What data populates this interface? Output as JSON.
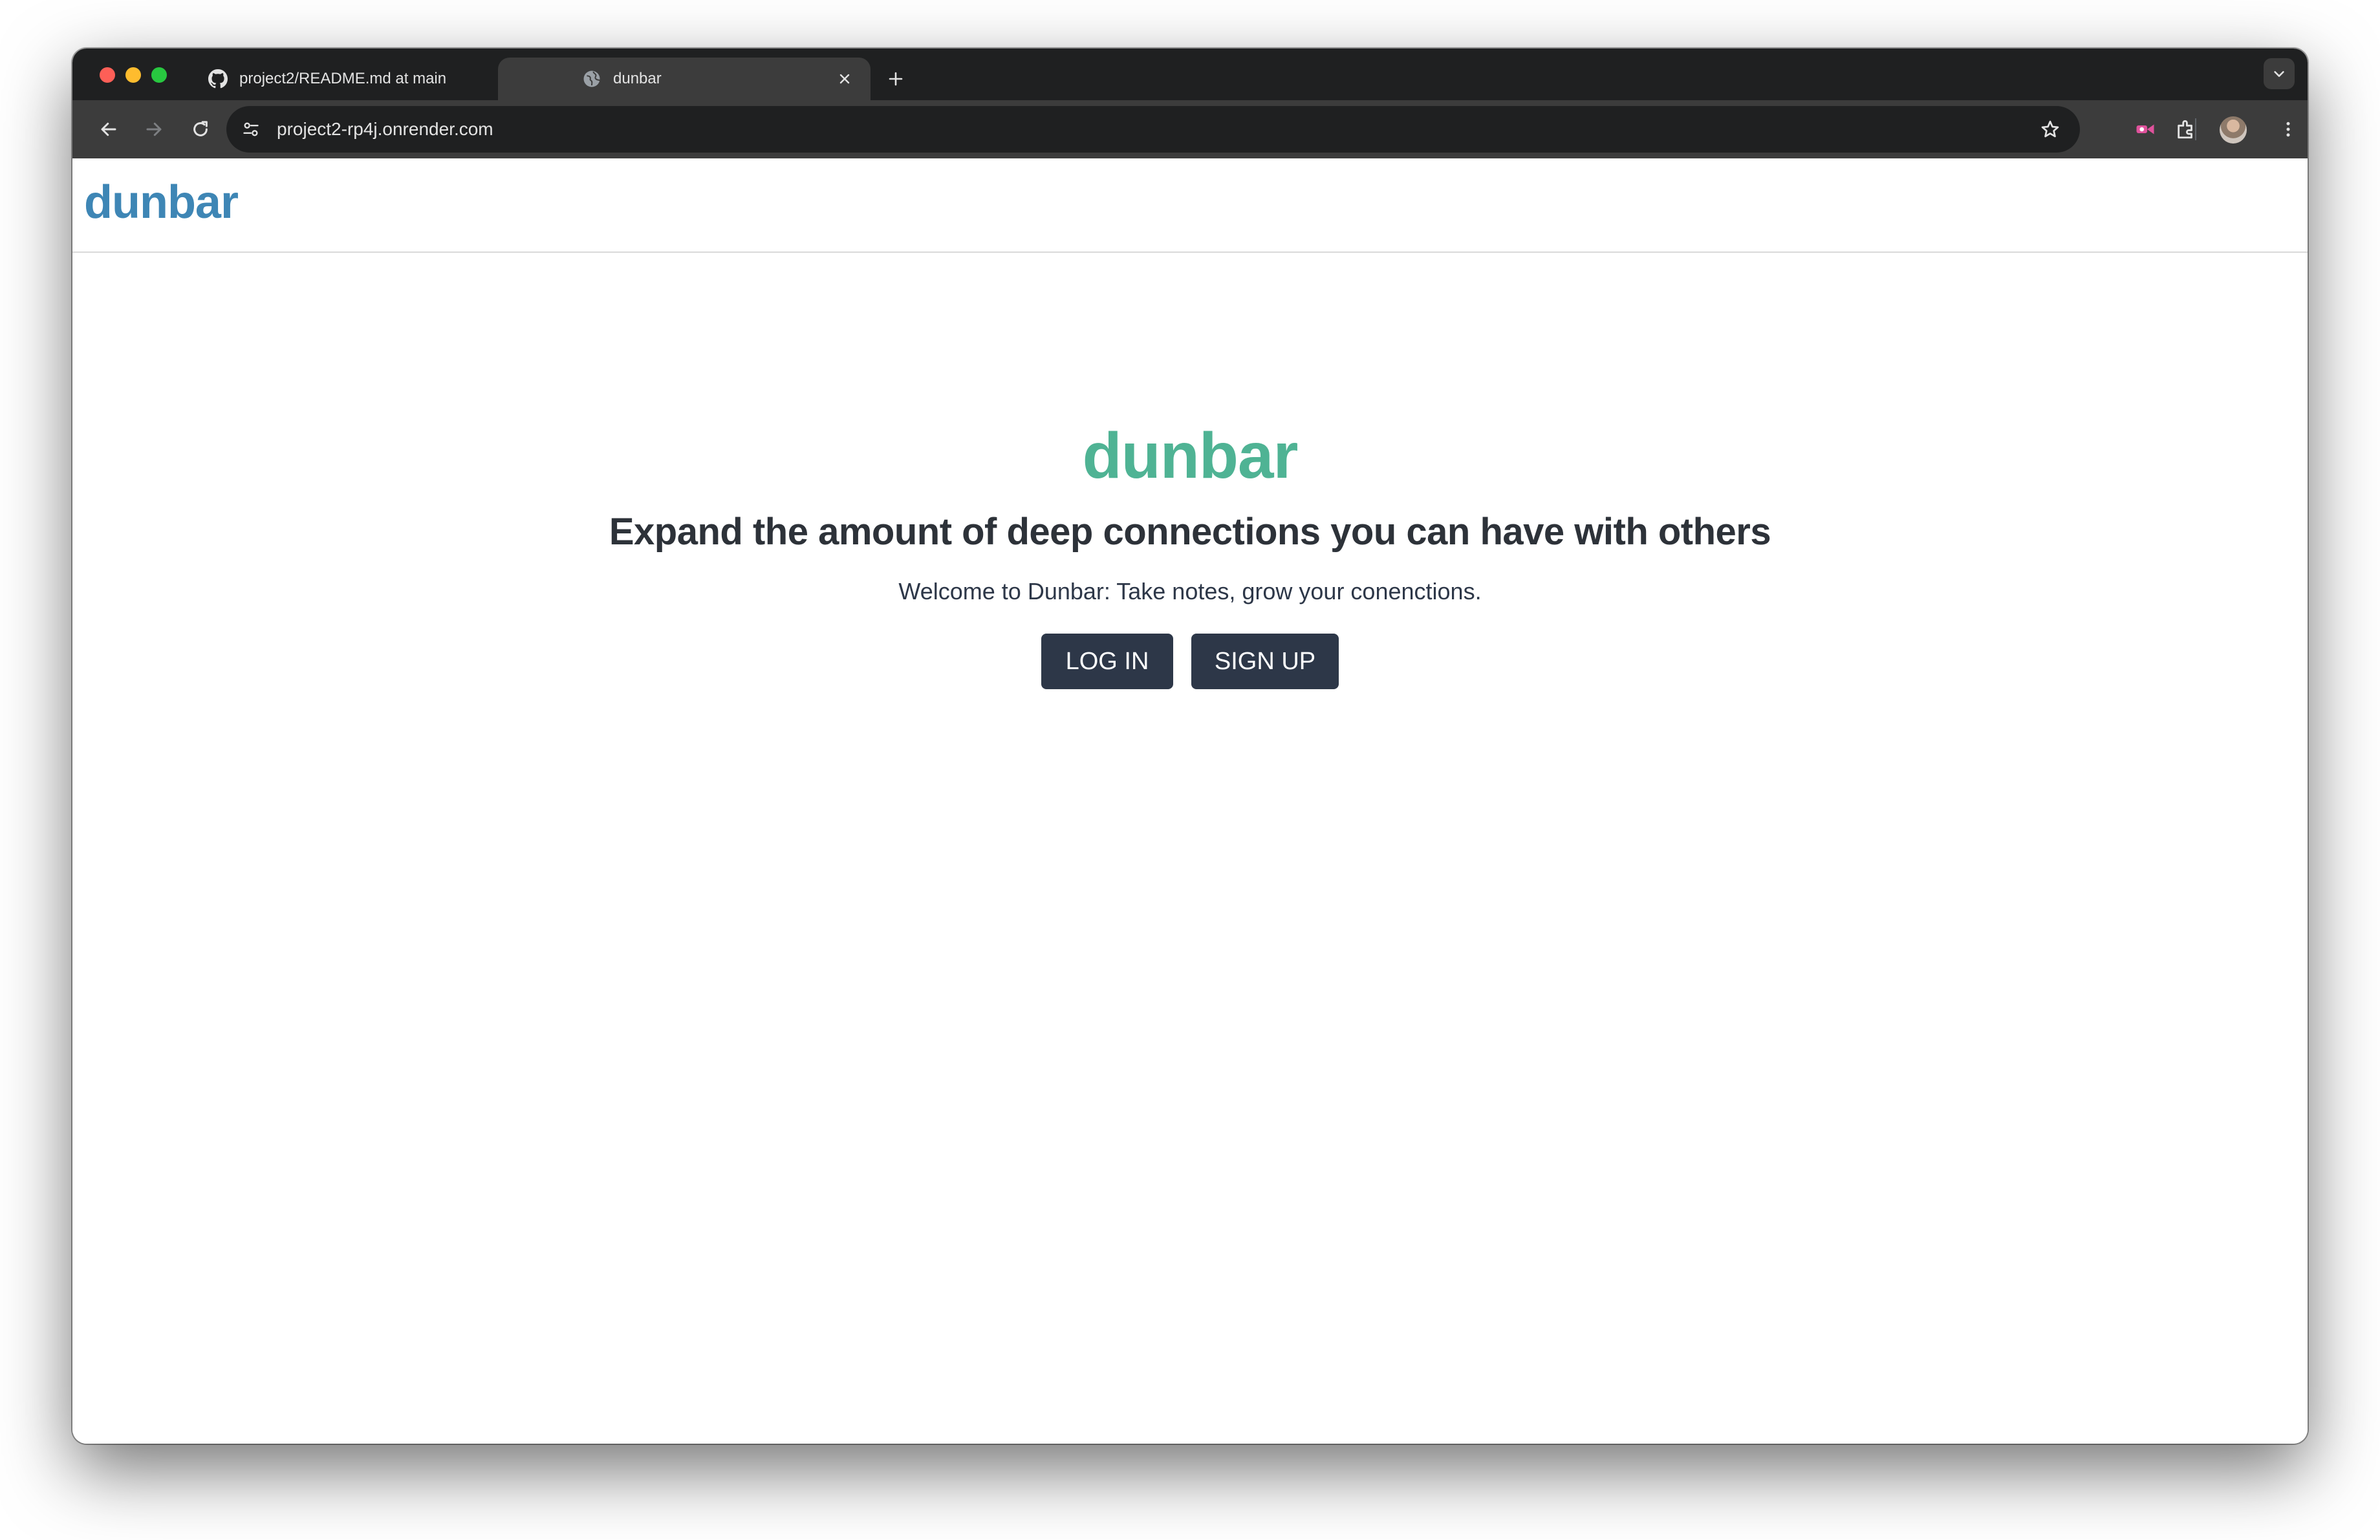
{
  "browser": {
    "tabs": [
      {
        "title": "project2/README.md at main",
        "favicon": "github-icon",
        "active": false
      },
      {
        "title": "dunbar",
        "favicon": "globe-icon",
        "active": true
      }
    ],
    "address_bar": {
      "url": "project2-rp4j.onrender.com"
    },
    "icons": {
      "back": "back-arrow-icon",
      "forward": "forward-arrow-icon",
      "reload": "reload-icon",
      "site_info": "tune-icon",
      "bookmark": "star-icon",
      "extension": "puzzle-icon",
      "menu": "kebab-menu-icon",
      "new_tab": "plus-icon",
      "tab_search": "chevron-down-icon"
    }
  },
  "site": {
    "header": {
      "logo": "dunbar"
    },
    "hero": {
      "title": "dunbar",
      "subtitle": "Expand the amount of deep connections you can have with others",
      "text": "Welcome to Dunbar: Take notes, grow your conenctions.",
      "login_label": "LOG IN",
      "signup_label": "SIGN UP"
    }
  },
  "colors": {
    "logo": "#3e86b5",
    "hero_title": "#4fb394",
    "button_bg": "#2d3748",
    "tabstrip_bg": "#1f2021",
    "toolbar_bg": "#3c3c3c"
  }
}
